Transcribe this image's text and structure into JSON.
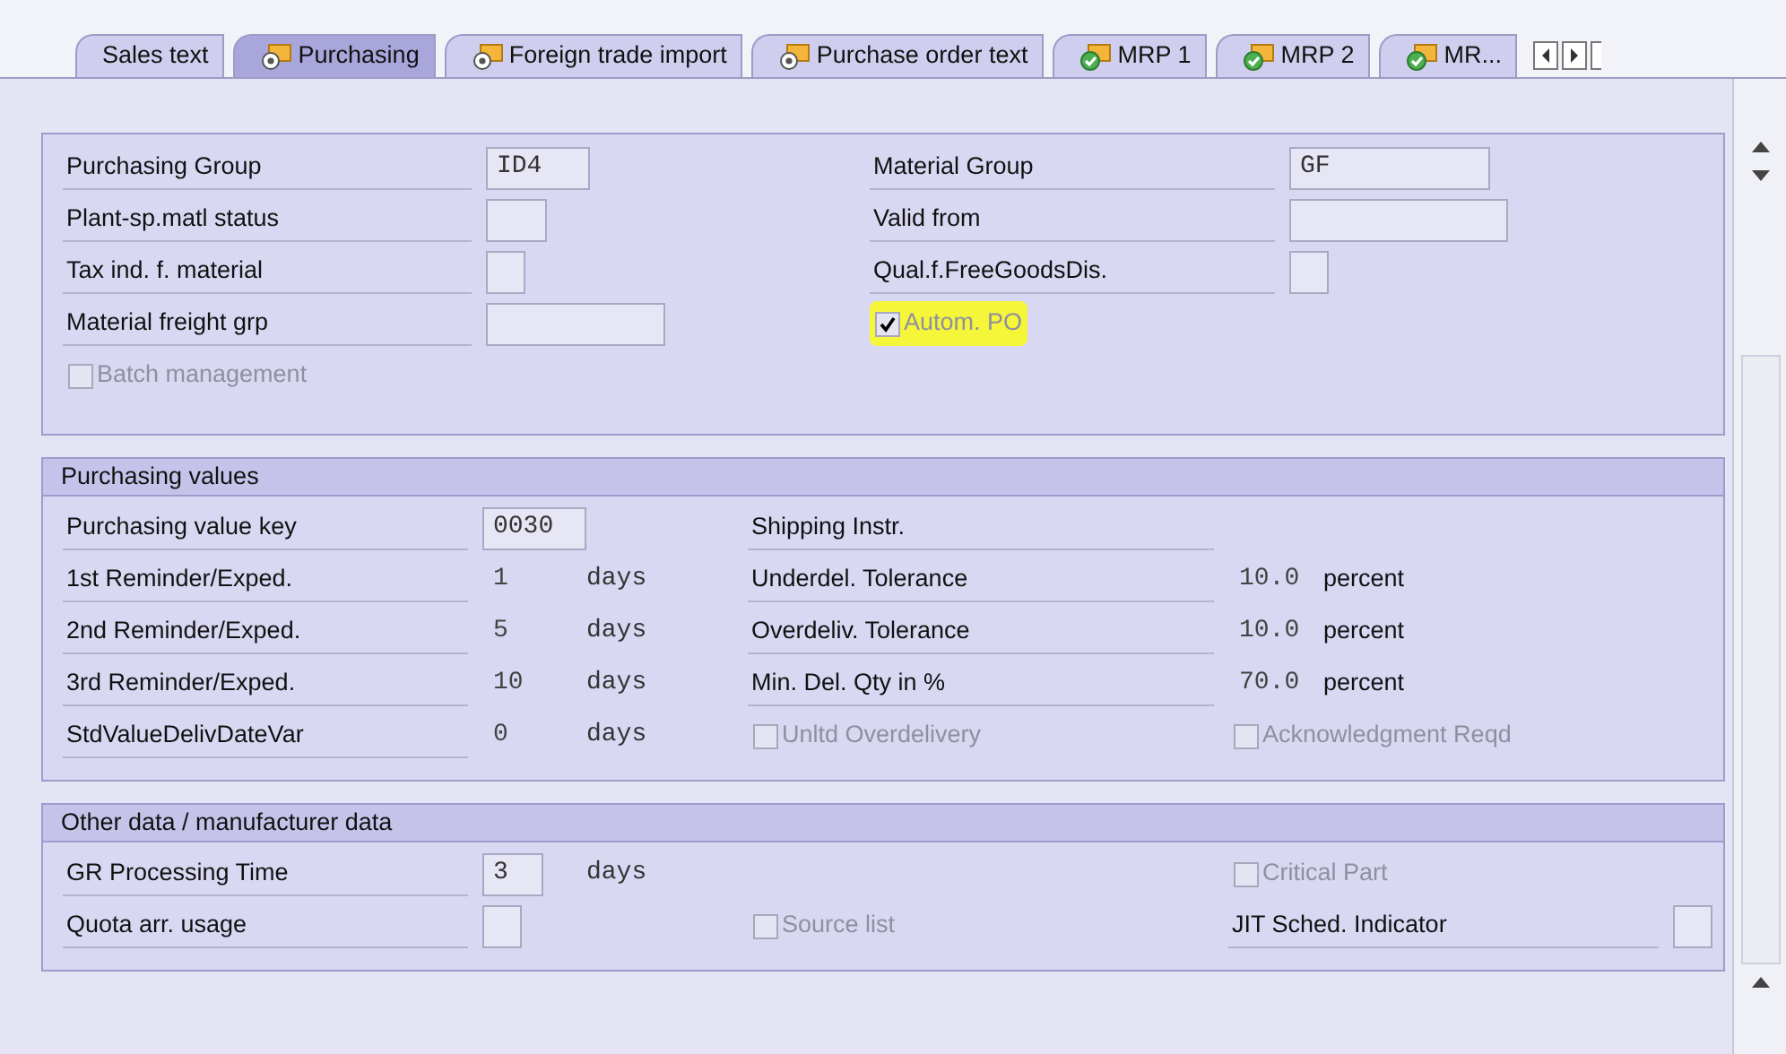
{
  "tabs": [
    {
      "label": "Sales text",
      "kind": "plain",
      "selected": false
    },
    {
      "label": "Purchasing",
      "kind": "pending",
      "selected": true
    },
    {
      "label": "Foreign trade import",
      "kind": "pending",
      "selected": false
    },
    {
      "label": "Purchase order text",
      "kind": "pending",
      "selected": false
    },
    {
      "label": "MRP 1",
      "kind": "done",
      "selected": false
    },
    {
      "label": "MRP 2",
      "kind": "done",
      "selected": false
    },
    {
      "label": "MR...",
      "kind": "done",
      "selected": false
    }
  ],
  "groups": [
    {
      "rows": [
        [
          {
            "kind": "label",
            "text": "Purchasing Group"
          },
          {
            "kind": "field",
            "value": "ID4"
          },
          {
            "kind": "label",
            "text": "Material Group"
          },
          {
            "kind": "field",
            "value": "GF"
          }
        ],
        [
          {
            "kind": "label",
            "text": "Plant-sp.matl status"
          },
          {
            "kind": "field"
          },
          {
            "kind": "label",
            "text": "Valid from"
          },
          {
            "kind": "field"
          }
        ],
        [
          {
            "kind": "label",
            "text": "Tax ind. f. material"
          },
          {
            "kind": "field"
          },
          {
            "kind": "label",
            "text": "Qual.f.FreeGoodsDis."
          },
          {
            "kind": "field"
          }
        ],
        [
          {
            "kind": "label",
            "text": "Material freight grp"
          },
          {
            "kind": "field"
          },
          {
            "kind": "checkbox",
            "text": "Autom. PO",
            "checked": true,
            "disabled": true,
            "highlighted": true
          }
        ],
        [
          {
            "kind": "checkbox",
            "text": "Batch management",
            "checked": false,
            "disabled": true,
            "highlighted": false
          }
        ]
      ]
    },
    {
      "title": "Purchasing values",
      "rows": [
        [
          {
            "kind": "label",
            "text": "Purchasing value key"
          },
          {
            "kind": "field",
            "value": "0030"
          },
          {
            "kind": "blank"
          },
          {
            "kind": "label",
            "text": "Shipping Instr."
          }
        ],
        [
          {
            "kind": "label",
            "text": "1st Reminder/Exped."
          },
          {
            "kind": "value",
            "text": "1"
          },
          {
            "kind": "unit",
            "text": "days"
          },
          {
            "kind": "label",
            "text": "Underdel. Tolerance"
          },
          {
            "kind": "value",
            "text": "10.0"
          },
          {
            "kind": "note",
            "text": "percent"
          }
        ],
        [
          {
            "kind": "label",
            "text": "2nd Reminder/Exped."
          },
          {
            "kind": "value",
            "text": "5"
          },
          {
            "kind": "unit",
            "text": "days"
          },
          {
            "kind": "label",
            "text": "Overdeliv. Tolerance"
          },
          {
            "kind": "value",
            "text": "10.0"
          },
          {
            "kind": "note",
            "text": "percent"
          }
        ],
        [
          {
            "kind": "label",
            "text": "3rd Reminder/Exped."
          },
          {
            "kind": "value",
            "text": "10"
          },
          {
            "kind": "unit",
            "text": "days"
          },
          {
            "kind": "label",
            "text": "Min. Del. Qty in %"
          },
          {
            "kind": "value",
            "text": "70.0"
          },
          {
            "kind": "note",
            "text": "percent"
          }
        ],
        [
          {
            "kind": "label",
            "text": "StdValueDelivDateVar"
          },
          {
            "kind": "value",
            "text": "0"
          },
          {
            "kind": "unit",
            "text": "days"
          },
          {
            "kind": "checkbox",
            "text": "Unltd Overdelivery",
            "checked": false,
            "disabled": true,
            "highlighted": false
          },
          {
            "kind": "checkbox",
            "text": "Acknowledgment Reqd",
            "checked": false,
            "disabled": true,
            "highlighted": false
          }
        ]
      ]
    },
    {
      "title": "Other data / manufacturer data",
      "rows": [
        [
          {
            "kind": "label",
            "text": "GR Processing Time"
          },
          {
            "kind": "field",
            "value": "3"
          },
          {
            "kind": "unit",
            "text": "days"
          },
          {
            "kind": "blank"
          },
          {
            "kind": "checkbox",
            "text": "Critical Part",
            "checked": false,
            "disabled": true,
            "highlighted": false
          }
        ],
        [
          {
            "kind": "label",
            "text": "Quota arr. usage"
          },
          {
            "kind": "field"
          },
          {
            "kind": "blank"
          },
          {
            "kind": "checkbox",
            "text": "Source list",
            "checked": false,
            "disabled": true,
            "highlighted": false
          },
          {
            "kind": "label",
            "text": "JIT Sched. Indicator"
          },
          {
            "kind": "field"
          }
        ]
      ]
    }
  ]
}
